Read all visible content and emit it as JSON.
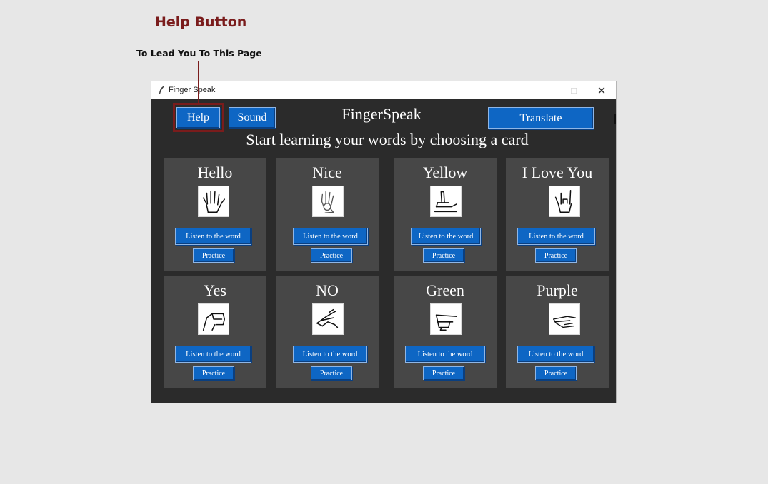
{
  "annotation": {
    "title": "Help Button",
    "subtitle": "To Lead You To This Page",
    "color": "#7a1c1c"
  },
  "window": {
    "title": "Finger Speak",
    "controls": {
      "minimize": "–",
      "maximize": "□",
      "close": "✕"
    }
  },
  "toolbar": {
    "help_label": "Help",
    "sound_label": "Sound",
    "translate_label": "Translate"
  },
  "app": {
    "title": "FingerSpeak",
    "subtitle": "Start learning your words by choosing a card"
  },
  "colors": {
    "window_bg": "#2b2b2b",
    "card_bg": "#474747",
    "button_bg": "#0e66c4"
  },
  "cards": [
    {
      "word": "Hello",
      "icon": "open-hand-icon",
      "listen_label": "Listen to the word",
      "practice_label": "Practice"
    },
    {
      "word": "Nice",
      "icon": "ok-hand-icon",
      "listen_label": "Listen to the word",
      "practice_label": "Practice"
    },
    {
      "word": "Yellow",
      "icon": "y-hand-icon",
      "listen_label": "Listen to the word",
      "practice_label": "Practice"
    },
    {
      "word": "I Love You",
      "icon": "i-love-you-hand-icon",
      "listen_label": "Listen to the word",
      "practice_label": "Practice"
    },
    {
      "word": "Yes",
      "icon": "fist-hand-icon",
      "listen_label": "Listen to the word",
      "practice_label": "Practice"
    },
    {
      "word": "NO",
      "icon": "no-hand-icon",
      "listen_label": "Listen to the word",
      "practice_label": "Practice"
    },
    {
      "word": "Green",
      "icon": "g-hand-icon",
      "listen_label": "Listen to the word",
      "practice_label": "Practice"
    },
    {
      "word": "Purple",
      "icon": "p-hand-icon",
      "listen_label": "Listen to the word",
      "practice_label": "Practice"
    }
  ]
}
